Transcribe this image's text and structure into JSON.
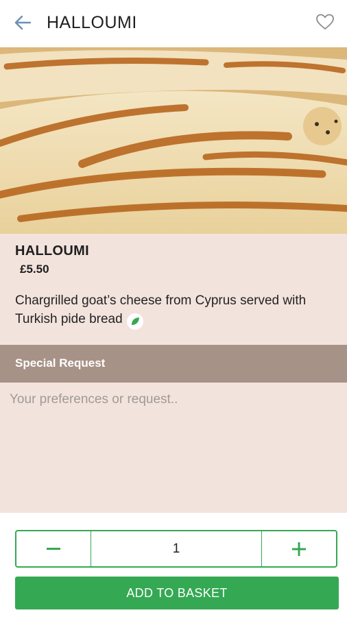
{
  "header": {
    "title": "HALLOUMI",
    "back_icon": "arrow-left-icon",
    "favorite_icon": "heart-outline-icon"
  },
  "item": {
    "name": "HALLOUMI",
    "price": "£5.50",
    "description": "Chargrilled goat’s cheese from Cyprus served with Turkish pide bread",
    "badge_icon": "vegetarian-leaf-icon"
  },
  "special_request": {
    "label": "Special Request",
    "placeholder": "Your preferences or request.."
  },
  "order": {
    "quantity": "1",
    "add_label": "ADD TO BASKET"
  },
  "colors": {
    "accent": "#34a853",
    "section_bg": "#f3e3dd",
    "bar_bg": "#a79288",
    "back_icon": "#6a8fb3"
  }
}
